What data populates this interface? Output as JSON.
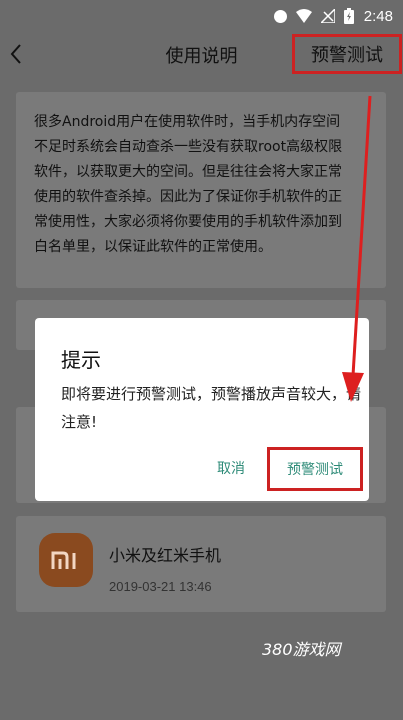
{
  "status": {
    "time": "2:48"
  },
  "nav": {
    "title": "使用说明",
    "right_label": "预警测试"
  },
  "intro": {
    "lines": [
      "很多Android用户在使用软件时，当手机内存空间",
      "不足时系统会自动查杀一些没有获取root高级权限",
      "软件，以获取更大的空间。但是往往会将大家正常",
      "使用的软件查杀掉。因此为了保证你手机软件的正",
      "常使用性，大家必须将你要使用的手机软件添加到",
      "白名单里，以保证此软件的正常使用。"
    ]
  },
  "brand_card": {
    "logo_text": "mi",
    "title": "小米及红米手机",
    "date": "2019-03-21 13:46"
  },
  "dialog": {
    "title": "提示",
    "message": "即将要进行预警测试，预警播放声音较大，请注意!",
    "cancel": "取消",
    "confirm": "预警测试"
  },
  "watermark": "380游戏网",
  "colors": {
    "accent": "#2e8b78",
    "highlight": "#cc2222",
    "logo": "#8a4a1f"
  }
}
